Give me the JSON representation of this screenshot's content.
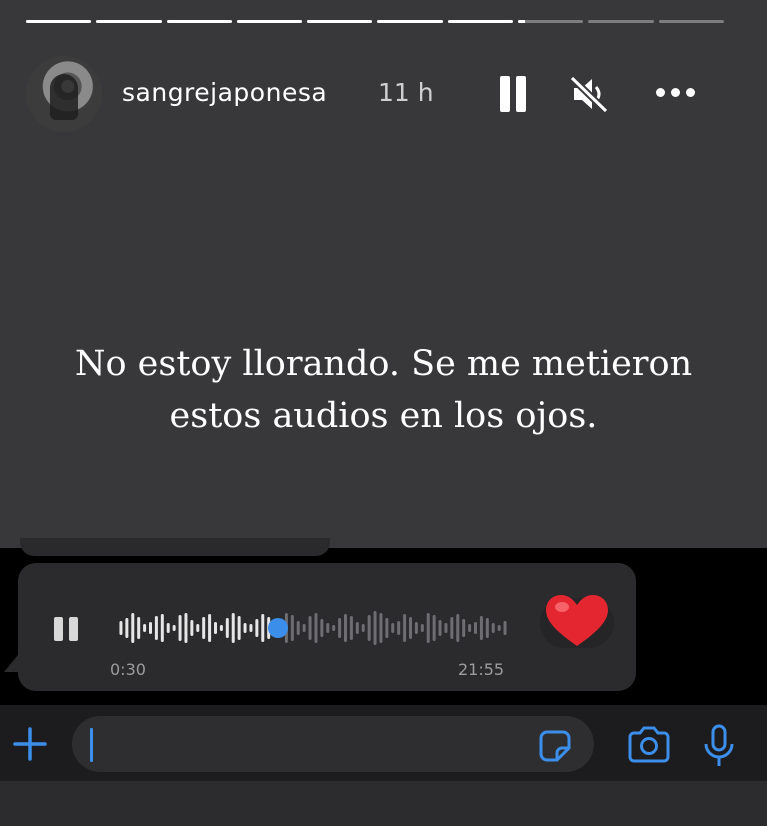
{
  "story": {
    "segments": [
      1,
      1,
      1,
      1,
      1,
      1,
      1,
      0.1,
      0,
      0
    ],
    "username": "sangrejaponesa",
    "time": "11 h",
    "text_line1": "No estoy llorando. Se me metieron",
    "text_line2": "estos audios en los ojos.",
    "icons": [
      "pause-icon",
      "mute-icon",
      "more-icon"
    ]
  },
  "voice_message": {
    "current_time": "0:30",
    "duration": "21:55",
    "progress": 0.4,
    "reaction": "❤️"
  },
  "composer": {
    "icons": [
      "plus-icon",
      "sticker-icon",
      "camera-icon",
      "microphone-icon"
    ]
  },
  "colors": {
    "accent": "#3b8eea",
    "story_bg": "#38383b",
    "bubble_bg": "#2b2b2e"
  }
}
